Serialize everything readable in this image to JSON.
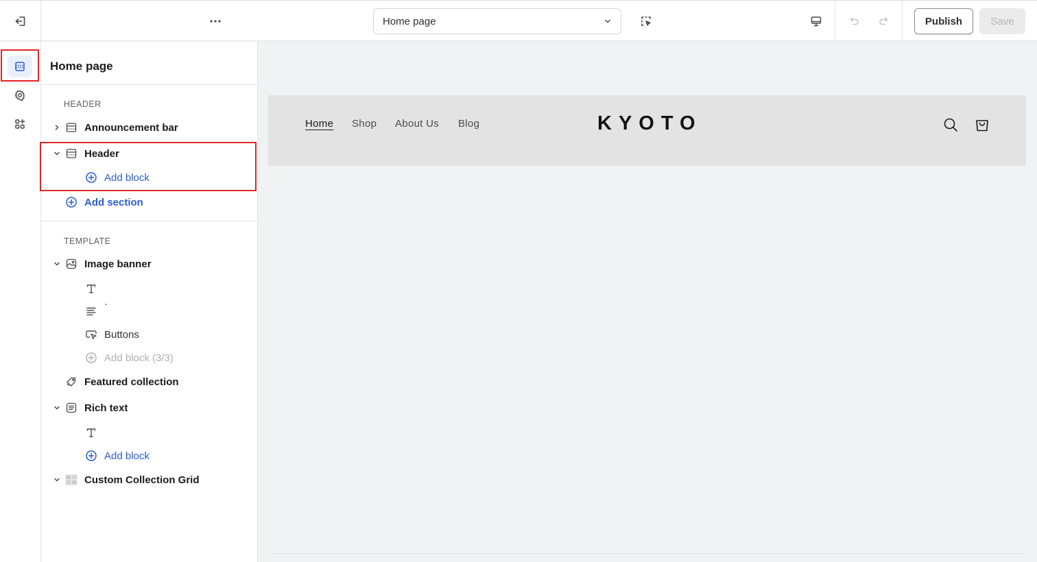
{
  "topbar": {
    "page_select_value": "Home page",
    "publish_label": "Publish",
    "save_label": "Save",
    "icons": [
      "exit-icon",
      "more-icon",
      "chevron-down-icon",
      "inspect-icon",
      "desktop-icon",
      "undo-icon",
      "redo-icon"
    ]
  },
  "rail": {
    "items": [
      {
        "icon": "sections-icon",
        "active": true
      },
      {
        "icon": "gear-icon",
        "active": false
      },
      {
        "icon": "apps-icon",
        "active": false
      }
    ]
  },
  "sidebar": {
    "title": "Home page",
    "header_group_label": "HEADER",
    "announcement_bar": "Announcement bar",
    "header_section": "Header",
    "header_add_block": "Add block",
    "add_section": "Add section",
    "template_group_label": "TEMPLATE",
    "image_banner": "Image banner",
    "image_banner_text_block": "",
    "image_banner_paragraph_block": "·",
    "image_banner_buttons": "Buttons",
    "image_banner_add_block": "Add block (3/3)",
    "featured_collection": "Featured collection",
    "rich_text": "Rich text",
    "rich_text_text_block": "",
    "rich_text_add_block": "Add block",
    "custom_collection_grid": "Custom Collection Grid"
  },
  "preview": {
    "nav": [
      "Home",
      "Shop",
      "About Us",
      "Blog"
    ],
    "brand": "KYOTO",
    "icons": [
      "search-icon",
      "cart-icon"
    ]
  },
  "colors": {
    "accent": "#2a5bd7",
    "highlight": "#e02424",
    "preview_bg": "#f1f2f4",
    "preview_header_bg": "#e3e3e3"
  }
}
